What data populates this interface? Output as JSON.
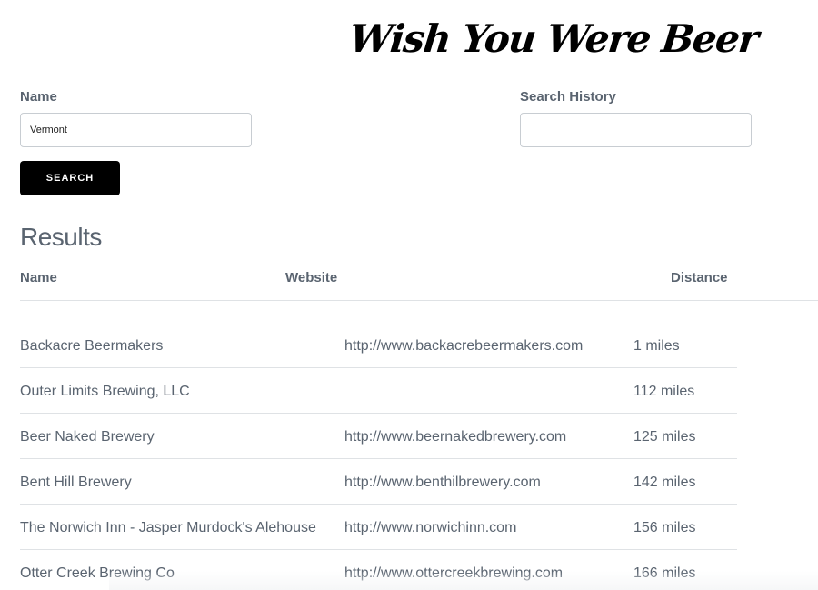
{
  "header": {
    "title": "Wish You Were Beer"
  },
  "form": {
    "name_label": "Name",
    "name_value": "Vermont",
    "history_label": "Search History",
    "history_value": "",
    "search_button": "SEARCH"
  },
  "results": {
    "heading": "Results",
    "columns": {
      "name": "Name",
      "website": "Website",
      "distance": "Distance"
    },
    "rows": [
      {
        "name": "Backacre Beermakers",
        "website": "http://www.backacrebeermakers.com",
        "distance": "1 miles"
      },
      {
        "name": "Outer Limits Brewing, LLC",
        "website": "",
        "distance": "112 miles"
      },
      {
        "name": "Beer Naked Brewery",
        "website": "http://www.beernakedbrewery.com",
        "distance": "125 miles"
      },
      {
        "name": "Bent Hill Brewery",
        "website": "http://www.benthilbrewery.com",
        "distance": "142 miles"
      },
      {
        "name": "The Norwich Inn - Jasper Murdock's Alehouse",
        "website": "http://www.norwichinn.com",
        "distance": "156 miles"
      },
      {
        "name": "Otter Creek Brewing Co",
        "website": "http://www.ottercreekbrewing.com",
        "distance": "166 miles"
      }
    ]
  }
}
